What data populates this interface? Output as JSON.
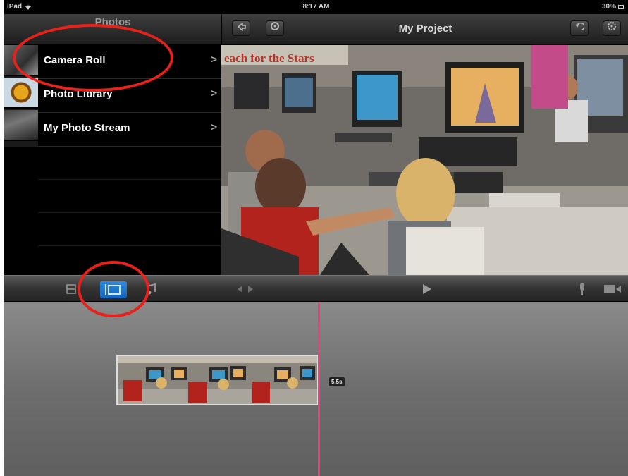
{
  "status_bar": {
    "carrier": "iPad",
    "time": "8:17 AM",
    "battery": "30%"
  },
  "media_browser": {
    "title": "Photos",
    "items": [
      {
        "label": "Camera Roll",
        "chevron": ">"
      },
      {
        "label": "Photo Library",
        "chevron": ">"
      },
      {
        "label": "My Photo Stream",
        "chevron": ">"
      }
    ]
  },
  "project": {
    "title": "My Project"
  },
  "preview": {
    "banner": "each for the Stars"
  },
  "timeline": {
    "clip_duration": "5.5s"
  },
  "annotations": {
    "color": "#e8221a"
  },
  "colors": {
    "playhead": "#e8427e",
    "active_tool": "#1f78d1"
  }
}
